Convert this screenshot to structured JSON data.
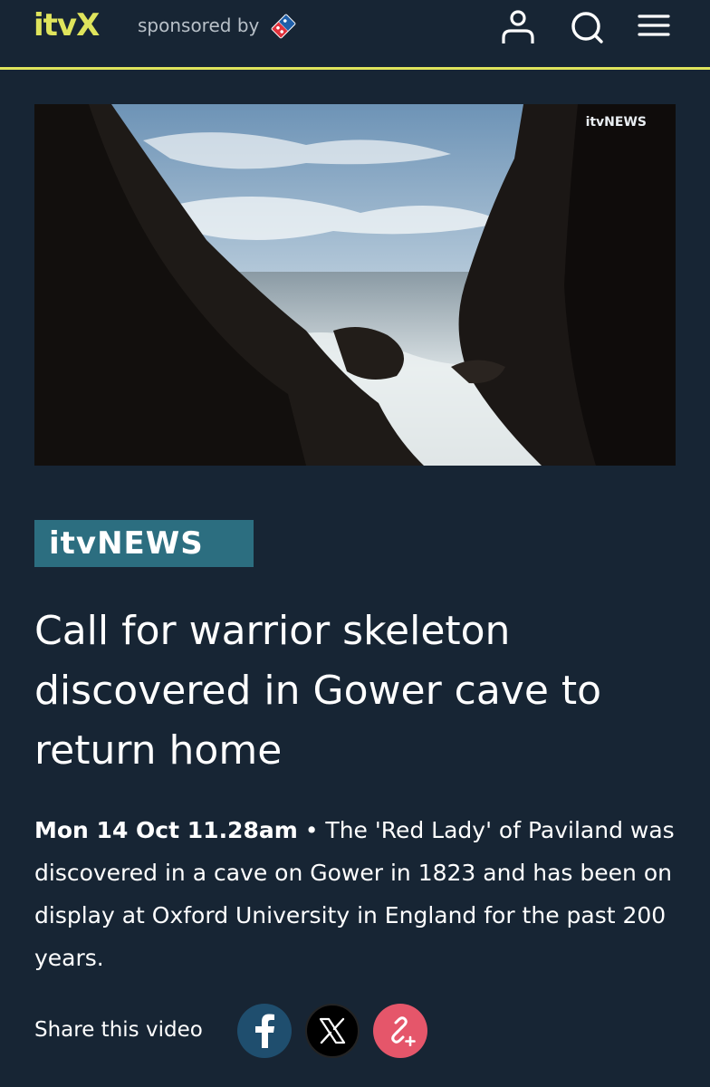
{
  "header": {
    "logo": "itvX",
    "sponsored_label": "sponsored by",
    "sponsor_icon": "dominos-icon",
    "icons": [
      "account-icon",
      "search-icon",
      "menu-icon"
    ]
  },
  "video": {
    "watermark": "itvNEWS"
  },
  "brand": {
    "label": "itvNEWS"
  },
  "article": {
    "headline": "Call for warrior skeleton discovered in Gower cave to return home",
    "date": "Mon 14 Oct 11.28am",
    "separator": " • ",
    "summary": "The 'Red Lady' of Paviland was discovered in a cave on Gower in 1823 and has been on display at Oxford University in England for the past 200 years."
  },
  "share": {
    "label": "Share this video",
    "buttons": [
      "facebook-icon",
      "x-icon",
      "copy-link-icon"
    ]
  },
  "colors": {
    "background": "#172534",
    "accent": "#dfe45c",
    "brand_teal": "#2c6e80",
    "link_pink": "#e5566a"
  }
}
